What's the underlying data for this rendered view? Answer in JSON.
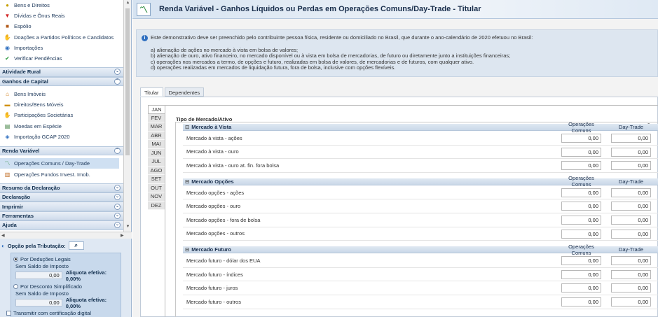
{
  "sidebar": {
    "top_items": [
      {
        "label": "Bens e Direitos",
        "icon": "coin-icon"
      },
      {
        "label": "Dívidas e Ônus Reais",
        "icon": "down-arrow-icon"
      },
      {
        "label": "Espólio",
        "icon": "briefcase-icon"
      },
      {
        "label": "Doações a Partidos Políticos e Candidatos",
        "icon": "hand-icon"
      },
      {
        "label": "Importações",
        "icon": "globe-icon"
      },
      {
        "label": "Verificar Pendências",
        "icon": "check-icon"
      }
    ],
    "sec_rural": "Atividade Rural",
    "sec_ganhos": "Ganhos de Capital",
    "ganhos_items": [
      {
        "label": "Bens Imóveis",
        "icon": "house-icon"
      },
      {
        "label": "Direitos/Bens Móveis",
        "icon": "car-icon"
      },
      {
        "label": "Participações Societárias",
        "icon": "handshake-icon"
      },
      {
        "label": "Moedas em Espécie",
        "icon": "money-icon"
      },
      {
        "label": "Importação GCAP 2020",
        "icon": "import-icon"
      }
    ],
    "sec_renda": "Renda Variável",
    "renda_items": [
      {
        "label": "Operações Comuns / Day-Trade",
        "icon": "chart-icon"
      },
      {
        "label": "Operações Fundos Invest. Imob.",
        "icon": "document-icon"
      }
    ],
    "bottom_sections": [
      "Resumo da Declaração",
      "Declaração",
      "Imprimir",
      "Ferramentas",
      "Ajuda"
    ]
  },
  "tributacao": {
    "title": "Opção pela Tributação:",
    "opt1": "Por Deduções Legais",
    "saldo1_label": "Sem Saldo de Imposto",
    "saldo1_value": "0,00",
    "aliq1": "Aliquota efetiva: 0,00%",
    "opt2": "Por Desconto Simplificado",
    "saldo2_label": "Sem Saldo de Imposto",
    "saldo2_value": "0,00",
    "aliq2": "Aliquota efetiva: 0,00%",
    "transmit": "Transmitir com certificação digital"
  },
  "header": {
    "title": "Renda Variável - Ganhos Líquidos ou Perdas em Operações Comuns/Day-Trade - Titular"
  },
  "info": {
    "intro": "Este demonstrativo deve ser preenchido pelo contribuinte pessoa física, residente ou domiciliado no Brasil, que durante o ano-calendário de 2020 efetuou no Brasil:",
    "items": [
      "a) alienação de ações no mercado à vista em bolsa de valores;",
      "b) alienação de ouro, ativo financeiro, no mercado disponível ou à vista em bolsa de mercadorias, de futuro ou diretamente junto a instituições financeiras;",
      "c) operações nos mercados a termo, de opções e futuro, realizadas em bolsa de valores, de mercadorias e de futuros, com qualquer ativo.",
      "d) operações realizadas em mercados de liquidação futura, fora de bolsa, inclusive com opções flexíveis."
    ]
  },
  "tabs": [
    "Titular",
    "Dependentes"
  ],
  "months": [
    "JAN",
    "FEV",
    "MAR",
    "ABR",
    "MAI",
    "JUN",
    "JUL",
    "AGO",
    "SET",
    "OUT",
    "NOV",
    "DEZ"
  ],
  "form": {
    "tipo_label": "Tipo de Mercado/Ativo",
    "col_comuns": "Operações Comuns",
    "col_day": "Day-Trade",
    "sections": [
      {
        "name": "Mercado à Vista",
        "rows": [
          {
            "label": "Mercado à vista - ações",
            "comuns": "0,00",
            "day": "0,00"
          },
          {
            "label": "Mercado à vista - ouro",
            "comuns": "0,00",
            "day": "0,00"
          },
          {
            "label": "Mercado à vista - ouro at. fin. fora bolsa",
            "comuns": "0,00",
            "day": "0,00"
          }
        ]
      },
      {
        "name": "Mercado Opções",
        "rows": [
          {
            "label": "Mercado opções - ações",
            "comuns": "0,00",
            "day": "0,00"
          },
          {
            "label": "Mercado opções - ouro",
            "comuns": "0,00",
            "day": "0,00"
          },
          {
            "label": "Mercado opções - fora de bolsa",
            "comuns": "0,00",
            "day": "0,00"
          },
          {
            "label": "Mercado opções - outros",
            "comuns": "0,00",
            "day": "0,00"
          }
        ]
      },
      {
        "name": "Mercado Futuro",
        "rows": [
          {
            "label": "Mercado futuro - dólar dos EUA",
            "comuns": "0,00",
            "day": "0,00"
          },
          {
            "label": "Mercado futuro - índices",
            "comuns": "0,00",
            "day": "0,00"
          },
          {
            "label": "Mercado futuro - juros",
            "comuns": "0,00",
            "day": "0,00"
          },
          {
            "label": "Mercado futuro - outros",
            "comuns": "0,00",
            "day": "0,00"
          }
        ]
      }
    ]
  }
}
